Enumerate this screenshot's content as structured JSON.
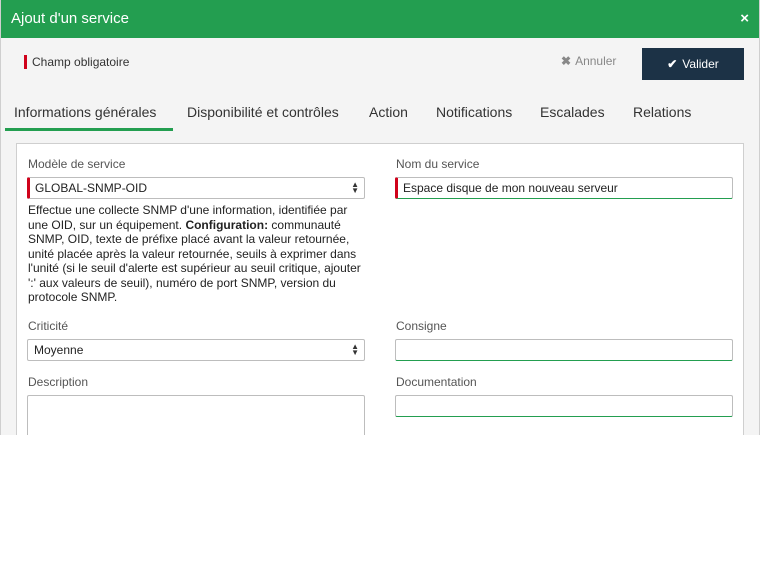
{
  "header": {
    "title": "Ajout d'un service",
    "close_icon": "×"
  },
  "toolbar": {
    "required_label": "Champ obligatoire",
    "cancel_label": "Annuler",
    "validate_label": "Valider"
  },
  "tabs": [
    {
      "label": "Informations générales",
      "active": true
    },
    {
      "label": "Disponibilité et contrôles"
    },
    {
      "label": "Action"
    },
    {
      "label": "Notifications"
    },
    {
      "label": "Escalades"
    },
    {
      "label": "Relations"
    }
  ],
  "form": {
    "model": {
      "label": "Modèle de service",
      "value": "GLOBAL-SNMP-OID"
    },
    "model_description": {
      "text": "Effectue une collecte SNMP d'une information, identifiée par une OID, sur un équipement. ",
      "bold": "Configuration:",
      "rest": " communauté SNMP, OID, texte de préfixe placé avant la valeur retournée, unité placée après la valeur retournée, seuils à exprimer dans l'unité (si le seuil d'alerte est supérieur au seuil critique, ajouter ':' aux valeurs de seuil), numéro de port SNMP, version du protocole SNMP."
    },
    "service_name": {
      "label": "Nom du service",
      "value": "Espace disque de mon nouveau serveur"
    },
    "criticality": {
      "label": "Criticité",
      "value": "Moyenne"
    },
    "instruction": {
      "label": "Consigne",
      "value": ""
    },
    "description": {
      "label": "Description",
      "value": ""
    },
    "documentation": {
      "label": "Documentation",
      "value": ""
    }
  },
  "colors": {
    "header": "#239e50",
    "validate_button": "#1c3246",
    "required": "#d0021b"
  }
}
